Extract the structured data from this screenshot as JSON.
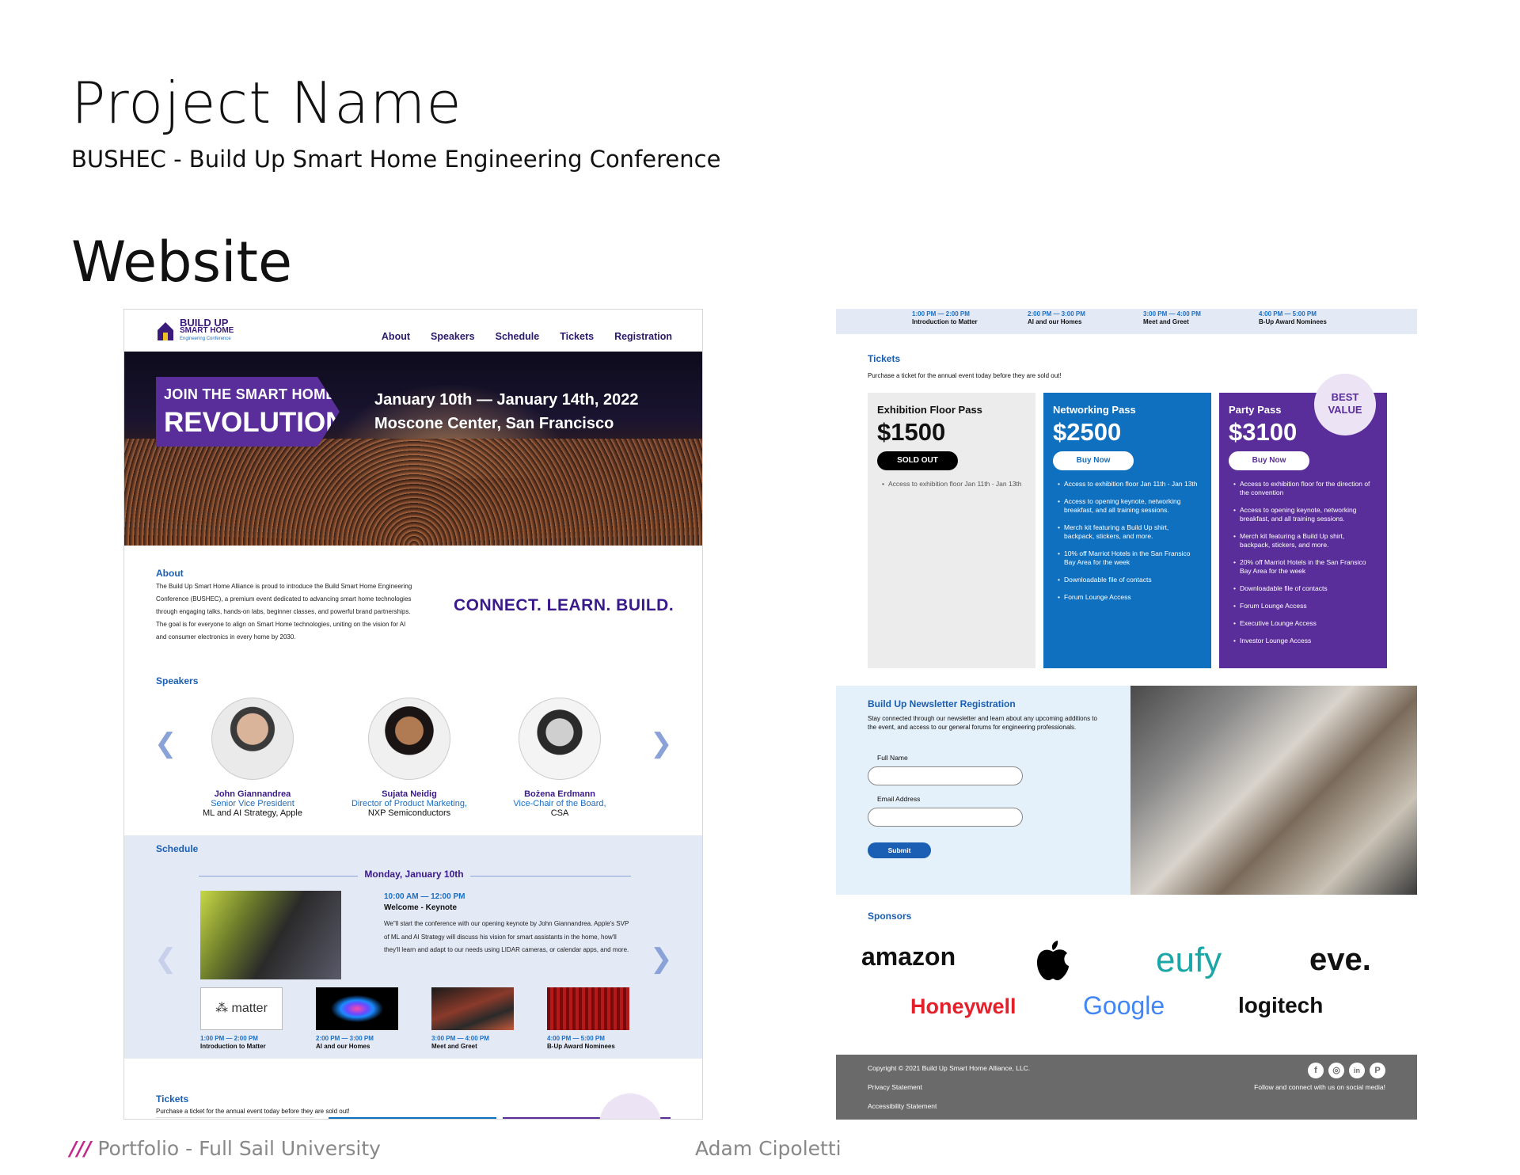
{
  "header": {
    "title": "Project Name",
    "subtitle": "BUSHEC - Build Up Smart Home Engineering Conference",
    "section": "Website"
  },
  "footer": {
    "left_marks": "///",
    "left": "Portfolio - Full Sail University",
    "right": "Adam Cipoletti"
  },
  "site": {
    "logo": {
      "line1": "BUILD UP",
      "line2": "SMART HOME",
      "line3": "Engineering Conference",
      "icon": "house-icon"
    },
    "nav": [
      "About",
      "Speakers",
      "Schedule",
      "Tickets",
      "Registration"
    ],
    "hero": {
      "banner_small": "JOIN THE SMART HOME",
      "banner_big": "REVOLUTION",
      "date": "January 10th — January 14th, 2022",
      "location": "Moscone Center, San Francisco"
    },
    "about": {
      "heading": "About",
      "text": "The Build Up Smart Home Alliance is proud to introduce the Build Smart Home Engineering Conference (BUSHEC), a premium event dedicated to advancing smart home technologies through engaging talks, hands-on labs, beginner classes, and powerful brand partnerships. The goal is for everyone to align on Smart Home technologies, uniting on the vision for AI and consumer electronics in every home by 2030.",
      "tagline": "CONNECT. LEARN. BUILD."
    },
    "speakers": {
      "heading": "Speakers",
      "items": [
        {
          "name": "John Giannandrea",
          "role1": "Senior Vice President",
          "role2": "ML and AI Strategy, Apple"
        },
        {
          "name": "Sujata Neidig",
          "role1": "Director of Product Marketing,",
          "role2": "NXP Semiconductors"
        },
        {
          "name": "Bożena Erdmann",
          "role1": "Vice-Chair of the Board,",
          "role2": "CSA"
        }
      ]
    },
    "schedule": {
      "heading": "Schedule",
      "day": "Monday, January 10th",
      "keynote": {
        "time": "10:00 AM — 12:00 PM",
        "title": "Welcome - Keynote",
        "desc": "We\"ll start the conference with our opening keynote by John Giannandrea. Apple's SVP of ML and AI Strategy will discuss his vision for smart assistants in the home, how'll they'll learn and adapt to our needs using LIDAR cameras, or calendar apps, and more."
      },
      "sessions": [
        {
          "time": "1:00 PM — 2:00 PM",
          "title": "Introduction to Matter",
          "thumb": "matter"
        },
        {
          "time": "2:00 PM — 3:00 PM",
          "title": "AI and our Homes",
          "thumb": ""
        },
        {
          "time": "3:00 PM — 4:00 PM",
          "title": "Meet and Greet",
          "thumb": ""
        },
        {
          "time": "4:00 PM — 5:00 PM",
          "title": "B-Up Award Nominees",
          "thumb": ""
        }
      ]
    },
    "tickets": {
      "heading": "Tickets",
      "intro": "Purchase a ticket for the annual event today before they are sold out!",
      "badge": [
        "BEST",
        "VALUE"
      ],
      "cards": [
        {
          "name": "Exhibition Floor Pass",
          "price": "$1500",
          "button": "SOLD OUT",
          "features": [
            "Access to exhibition floor Jan 11th - Jan 13th"
          ]
        },
        {
          "name": "Networking Pass",
          "price": "$2500",
          "button": "Buy Now",
          "features": [
            "Access to exhibition floor Jan 11th - Jan 13th",
            "Access to opening keynote, networking breakfast, and all training sessions.",
            "Merch kit featuring a Build Up shirt, backpack, stickers, and more.",
            "10% off Marriot Hotels in the San Fransico Bay Area for the week",
            "Downloadable file of contacts",
            "Forum Lounge Access"
          ]
        },
        {
          "name": "Party Pass",
          "price": "$3100",
          "button": "Buy Now",
          "features": [
            "Access to exhibition floor for the direction of the convention",
            "Access to opening keynote, networking breakfast, and all training sessions.",
            "Merch kit featuring a Build Up shirt, backpack, stickers, and more.",
            "20% off Marriot Hotels in the San Fransico Bay Area for the week",
            "Downloadable file of contacts",
            "Forum Lounge Access",
            "Executive Lounge Access",
            "Investor Lounge Access"
          ]
        }
      ]
    },
    "newsletter": {
      "heading": "Build Up Newsletter Registration",
      "text": "Stay connected through our newsletter and learn about any upcoming additions to the event, and access to our general forums for engineering professionals.",
      "name_label": "Full Name",
      "email_label": "Email Address",
      "submit": "Submit"
    },
    "sponsors": {
      "heading": "Sponsors",
      "logos": [
        "amazon",
        "",
        "eufy",
        "eve.",
        "Honeywell",
        "Google",
        "logitech"
      ]
    },
    "site_footer": {
      "copyright": "Copyright © 2021 Build Up Smart Home Alliance, LLC.",
      "privacy": "Privacy Statement",
      "accessibility": "Accessibility Statement",
      "social_text": "Follow and connect with us on social media!",
      "social": [
        "f",
        "◎",
        "in",
        "P"
      ]
    }
  },
  "colors": {
    "brand_purple": "#3a1a8a",
    "brand_blue": "#1a5fb4",
    "networking_blue": "#1070c0",
    "party_purple": "#5a2e9a",
    "light_bg": "#e4e9f6"
  }
}
